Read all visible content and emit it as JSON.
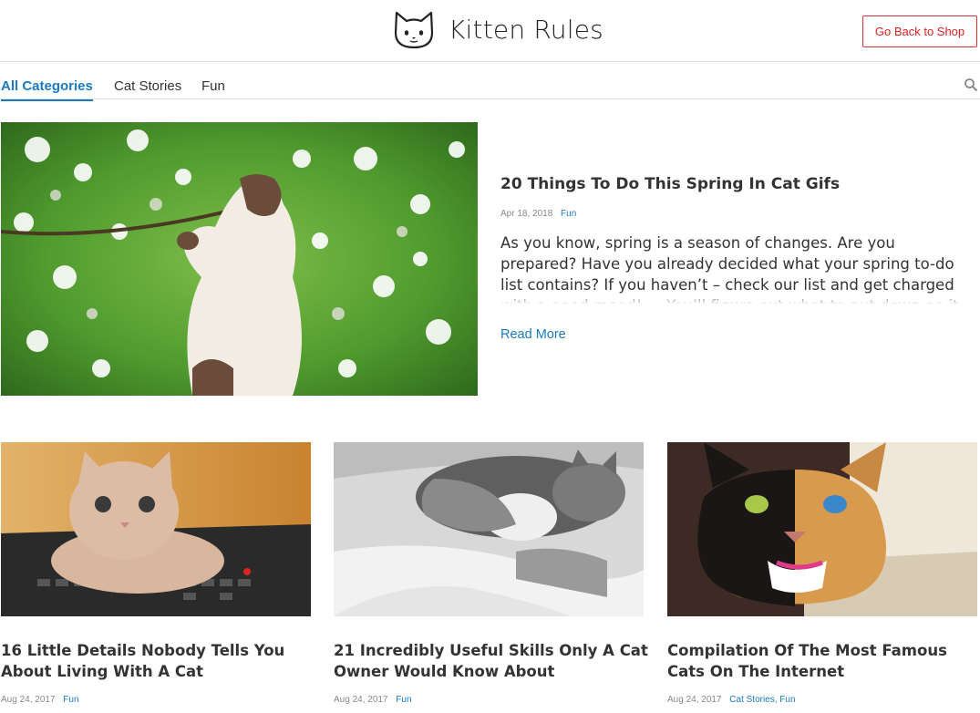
{
  "header": {
    "brand": "Kitten Rules",
    "logo_icon": "cat-face-icon",
    "shop_button": "Go Back to Shop",
    "accent_color": "#d22222"
  },
  "nav": {
    "tabs": [
      {
        "label": "All Categories",
        "active": true
      },
      {
        "label": "Cat Stories",
        "active": false
      },
      {
        "label": "Fun",
        "active": false
      }
    ],
    "search_icon": "search-icon",
    "link_color": "#1a7bc1"
  },
  "featured": {
    "image": "cat-in-spring-blossoms",
    "title": "20 Things To Do This Spring In Cat Gifs",
    "date": "Apr 18, 2018",
    "category": "Fun",
    "excerpt": "As you know, spring is a season of changes. Are you prepared? Have you already decided what your spring to-do list contains? If you haven’t – check our list and get charged with a good mood! … You’ll figure out what to put down on it. Your to-do list is outside.",
    "read_more": "Read More"
  },
  "posts": [
    {
      "image": "kitten-on-keyboard",
      "title": "16 Little Details Nobody Tells You About Living With A Cat",
      "date": "Aug 24, 2017",
      "categories": "Fun"
    },
    {
      "image": "girl-sleeping-with-cat",
      "title": "21 Incredibly Useful Skills Only A Cat Owner Would Know About",
      "date": "Aug 24, 2017",
      "categories": "Fun"
    },
    {
      "image": "two-faced-cat",
      "title": "Compilation Of The Most Famous Cats On The Internet",
      "date": "Aug 24, 2017",
      "categories": "Cat Stories, Fun"
    }
  ]
}
